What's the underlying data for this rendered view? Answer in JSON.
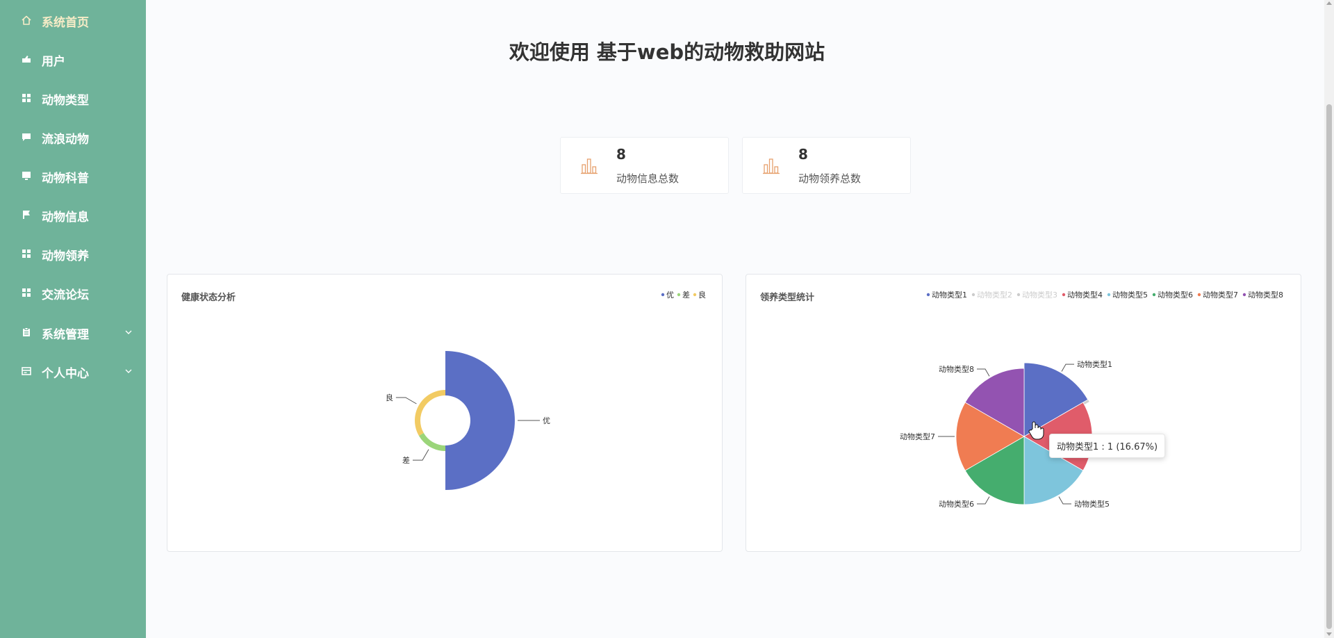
{
  "colors": {
    "sidebar_bg": "#6fb39a",
    "sidebar_active": "#f7ecc7",
    "stat_icon": "#e6a06d"
  },
  "sidebar": {
    "items": [
      {
        "label": "系统首页",
        "icon": "home-icon",
        "active": true
      },
      {
        "label": "用户",
        "icon": "user-icon"
      },
      {
        "label": "动物类型",
        "icon": "grid-icon"
      },
      {
        "label": "流浪动物",
        "icon": "chat-icon"
      },
      {
        "label": "动物科普",
        "icon": "monitor-icon"
      },
      {
        "label": "动物信息",
        "icon": "flag-icon"
      },
      {
        "label": "动物领养",
        "icon": "grid-icon"
      },
      {
        "label": "交流论坛",
        "icon": "grid-icon"
      },
      {
        "label": "系统管理",
        "icon": "clipboard-icon",
        "expandable": true
      },
      {
        "label": "个人中心",
        "icon": "card-icon",
        "expandable": true
      }
    ]
  },
  "header": {
    "title": "欢迎使用 基于web的动物救助网站"
  },
  "stats": [
    {
      "value": "8",
      "label": "动物信息总数",
      "icon": "bar-chart-icon"
    },
    {
      "value": "8",
      "label": "动物领养总数",
      "icon": "bar-chart-icon"
    }
  ],
  "chart_data": [
    {
      "type": "pie",
      "subtype": "nightingale-rose",
      "title": "健康状态分析",
      "legend": {
        "position": "top-right",
        "items": [
          "优",
          "差",
          "良"
        ]
      },
      "slices": [
        {
          "name": "优",
          "value": 3,
          "color": "#5b6fc5"
        },
        {
          "name": "差",
          "value": 1,
          "color": "#9bd57a"
        },
        {
          "name": "良",
          "value": 2,
          "color": "#f2cb63"
        }
      ]
    },
    {
      "type": "pie",
      "title": "领养类型统计",
      "legend": {
        "position": "top-right",
        "items": [
          {
            "name": "动物类型1",
            "color": "#5b6fc5",
            "active": true
          },
          {
            "name": "动物类型2",
            "color": "#9bd57a",
            "active": false
          },
          {
            "name": "动物类型3",
            "color": "#f2cb63",
            "active": false
          },
          {
            "name": "动物类型4",
            "color": "#e05c6a",
            "active": true
          },
          {
            "name": "动物类型5",
            "color": "#7ec5dc",
            "active": true
          },
          {
            "name": "动物类型6",
            "color": "#45ad6e",
            "active": true
          },
          {
            "name": "动物类型7",
            "color": "#f07c52",
            "active": true
          },
          {
            "name": "动物类型8",
            "color": "#9353b1",
            "active": true
          }
        ]
      },
      "slices": [
        {
          "name": "动物类型1",
          "value": 1,
          "color": "#5b6fc5",
          "highlighted": true
        },
        {
          "name": "动物类型4",
          "value": 1,
          "color": "#e05c6a"
        },
        {
          "name": "动物类型5",
          "value": 1,
          "color": "#7ec5dc"
        },
        {
          "name": "动物类型6",
          "value": 1,
          "color": "#45ad6e"
        },
        {
          "name": "动物类型7",
          "value": 1,
          "color": "#f07c52"
        },
        {
          "name": "动物类型8",
          "value": 1,
          "color": "#9353b1"
        }
      ],
      "outer_labels": [
        "动物类型1",
        "动物类型5",
        "动物类型6",
        "动物类型7",
        "动物类型8"
      ],
      "tooltip": "动物类型1 : 1 (16.67%)"
    }
  ]
}
